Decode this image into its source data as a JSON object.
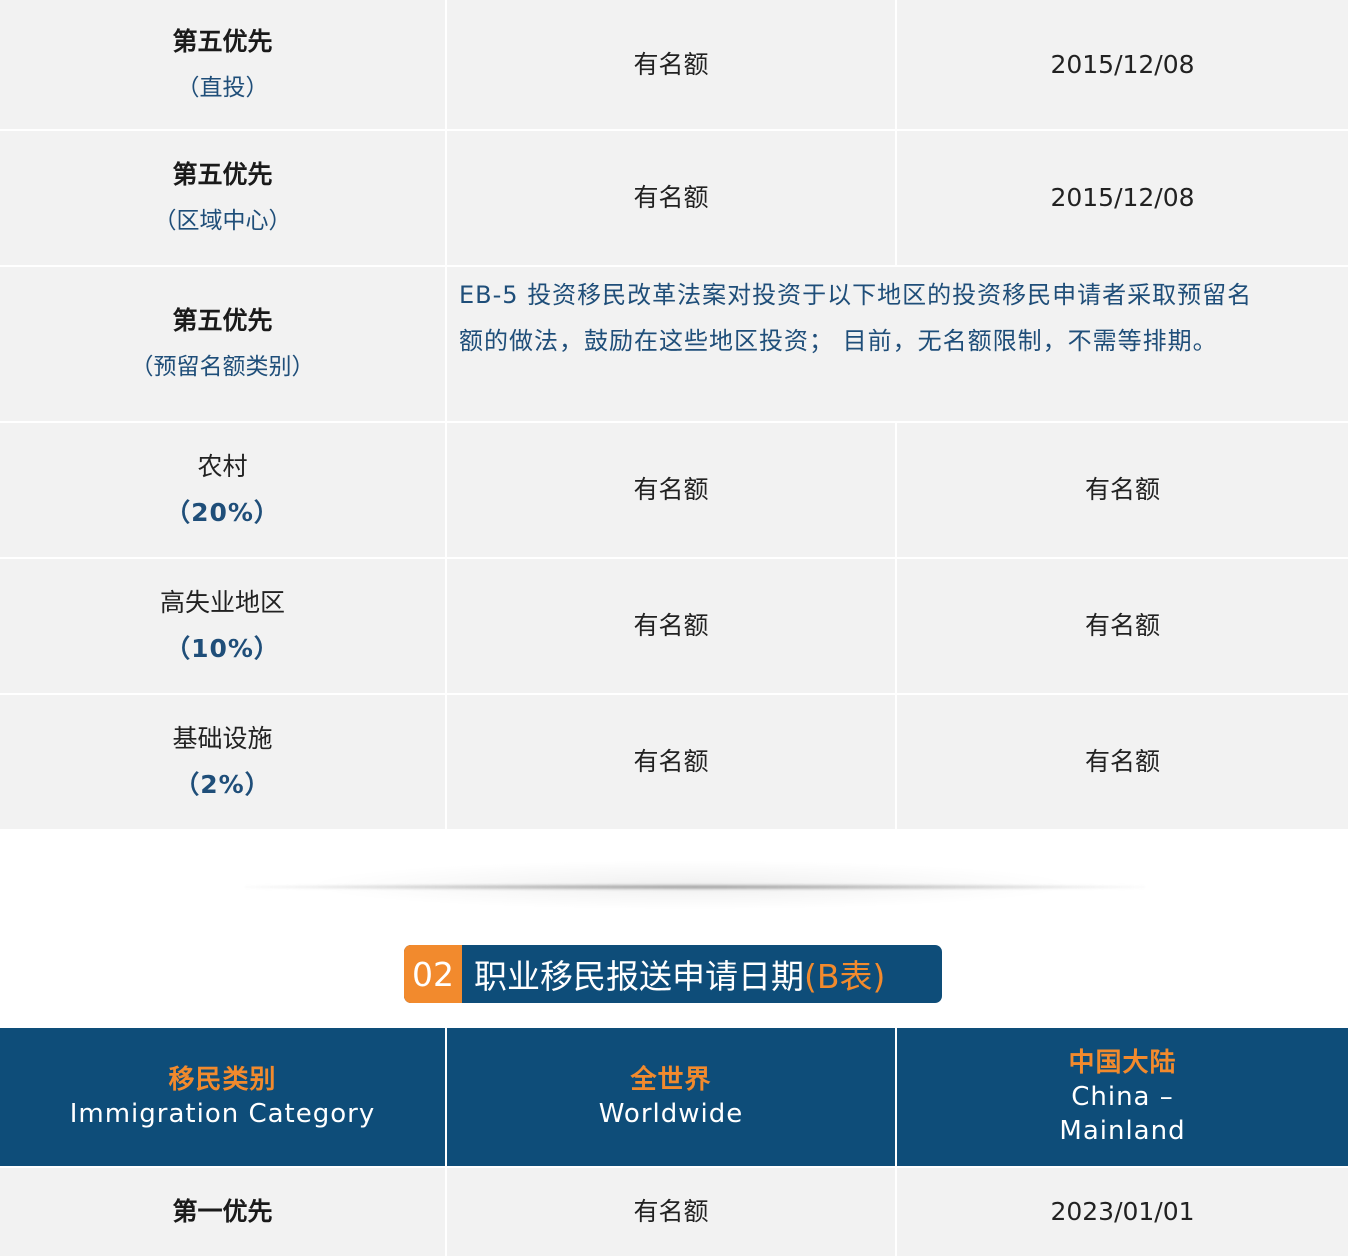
{
  "table_a": {
    "rows": [
      {
        "label": "第五优先",
        "sub": "（直投）",
        "col2": "有名额",
        "col3": "2015/12/08"
      },
      {
        "label": "第五优先",
        "sub": "（区域中心）",
        "col2": "有名额",
        "col3": "2015/12/08"
      },
      {
        "label": "第五优先",
        "sub": "（预留名额类别）",
        "note_line1": "EB-5 投资移民改革法案对投资于以下地区的投资移民申请者采取预留名",
        "note_line2": "额的做法，鼓励在这些地区投资； 目前，无名额限制，不需等排期。"
      },
      {
        "label": "农村",
        "sub": "（20%）",
        "col2": "有名额",
        "col3": "有名额"
      },
      {
        "label": "高失业地区",
        "sub": "（10%）",
        "col2": "有名额",
        "col3": "有名额"
      },
      {
        "label": "基础设施",
        "sub": "（2%）",
        "col2": "有名额",
        "col3": "有名额"
      }
    ]
  },
  "section": {
    "number": "02",
    "title": "职业移民报送申请日期",
    "title_accent": "(B表)"
  },
  "table_b": {
    "headers": [
      {
        "zh": "移民类别",
        "en": "Immigration Category"
      },
      {
        "zh": "全世界",
        "en": "Worldwide"
      },
      {
        "zh": "中国大陆",
        "en_line1": "China –",
        "en_line2": "Mainland"
      }
    ],
    "rows": [
      {
        "label": "第一优先",
        "col2": "有名额",
        "col3": "2023/01/01"
      }
    ]
  },
  "colors": {
    "navy": "#0e4d79",
    "orange": "#f28a2d",
    "row_bg": "#f2f2f2",
    "blue_text": "#1f4e79"
  }
}
